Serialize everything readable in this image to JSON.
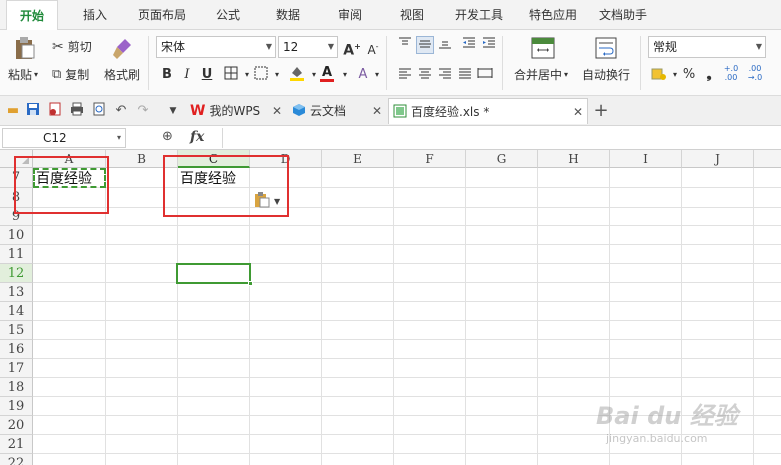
{
  "menu": {
    "tabs": [
      {
        "label": "开始",
        "active": true
      },
      {
        "label": "插入"
      },
      {
        "label": "页面布局"
      },
      {
        "label": "公式"
      },
      {
        "label": "数据"
      },
      {
        "label": "审阅"
      },
      {
        "label": "视图"
      },
      {
        "label": "开发工具"
      },
      {
        "label": "特色应用"
      },
      {
        "label": "文档助手"
      }
    ]
  },
  "ribbon": {
    "paste_label": "粘贴",
    "cut_label": "剪切",
    "copy_label": "复制",
    "format_painter_label": "格式刷",
    "font_name": "宋体",
    "font_size": "12",
    "bold": "B",
    "italic": "I",
    "underline": "U",
    "font_color_glyph": "A",
    "increase_font_glyph": "A",
    "decrease_font_glyph": "A",
    "merge_center_label": "合并居中",
    "wrap_text_label": "自动换行",
    "number_format": "常规",
    "percent_glyph": "%",
    "comma_glyph": "❟",
    "inc_decimal_glyph": "+.0\n.00",
    "dec_decimal_glyph": ".00\n→.0",
    "colors": {
      "font_color_bar": "#e02020",
      "fill_color_bar": "#ffd700",
      "accent": "#1f8a3a"
    }
  },
  "doc_tabs": [
    {
      "label": "我的WPS",
      "icon": "wps-logo-icon"
    },
    {
      "label": "云文档",
      "icon": "cloud-cube-icon"
    },
    {
      "label": "百度经验.xls *",
      "icon": "spreadsheet-icon",
      "active": true
    }
  ],
  "formula_bar": {
    "cell_ref": "C12",
    "fx": "fx"
  },
  "sheet": {
    "columns": [
      "A",
      "B",
      "C",
      "D",
      "E",
      "F",
      "G",
      "H",
      "I",
      "J"
    ],
    "rows": [
      "7",
      "8",
      "9",
      "10",
      "11",
      "12",
      "13",
      "14",
      "15",
      "16",
      "17",
      "18",
      "19",
      "20",
      "21",
      "22"
    ],
    "selected_col": "C",
    "selected_row": "12",
    "cell_a7": "百度经验",
    "cell_c7": "百度经验"
  },
  "watermark": {
    "brand": "Bai du 经验",
    "url": "jingyan.baidu.com"
  }
}
